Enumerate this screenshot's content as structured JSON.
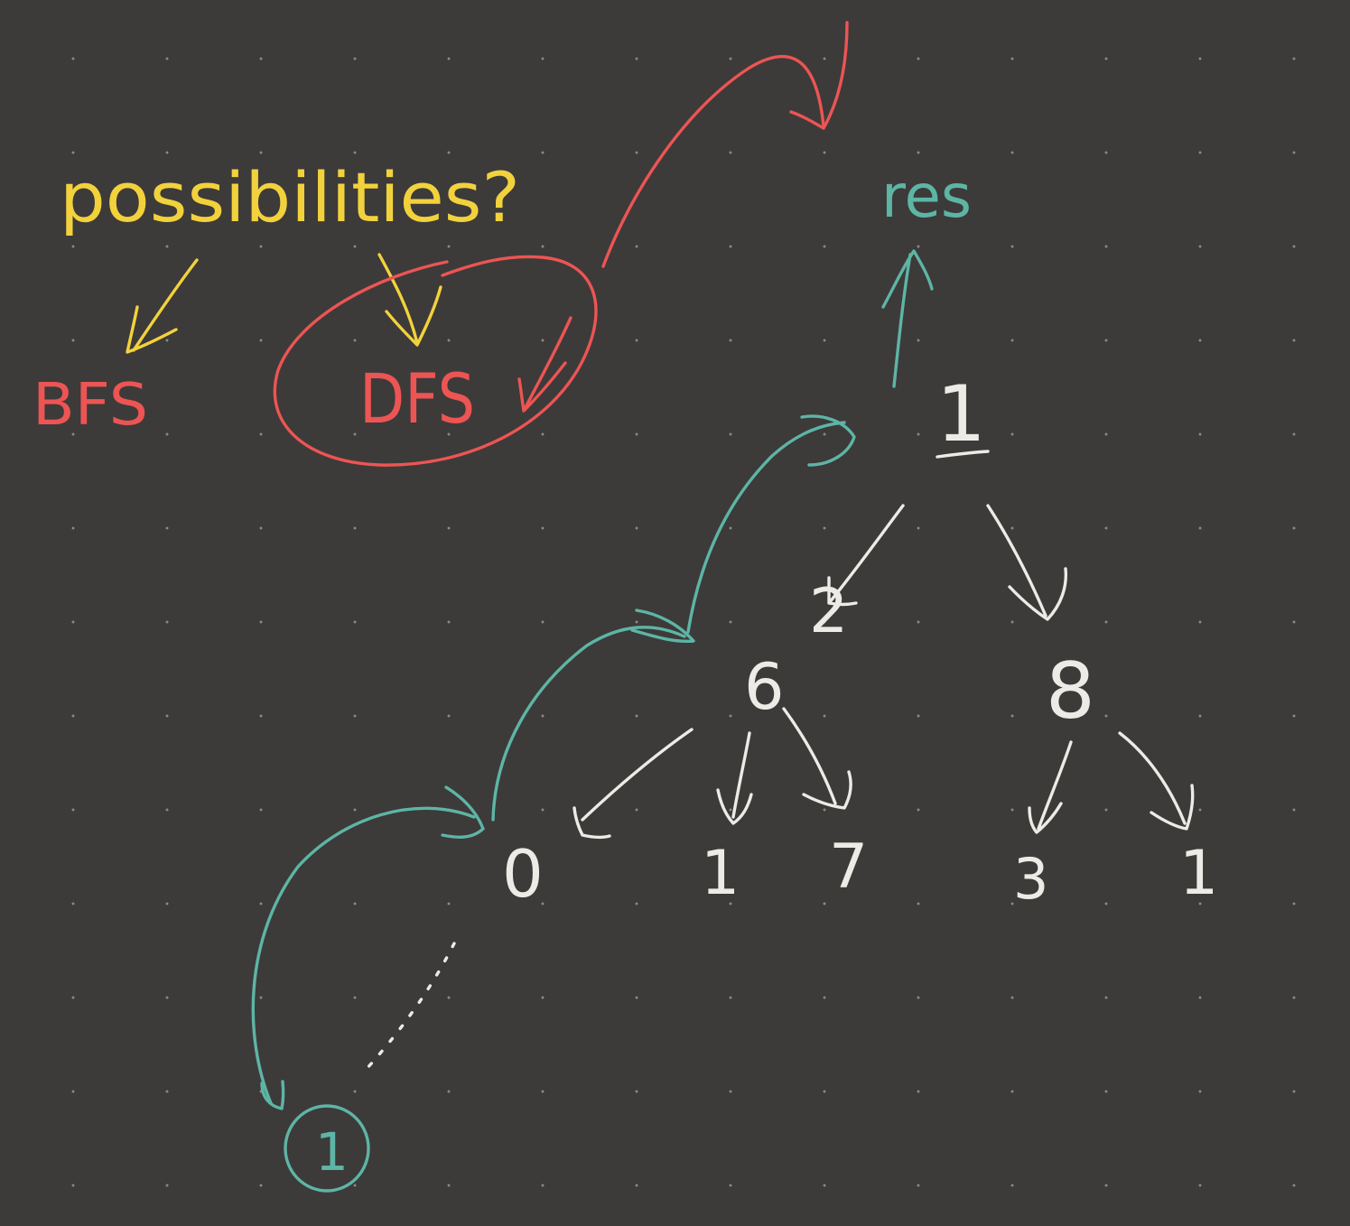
{
  "canvas": {
    "background_color": "#3d3a3a",
    "dot_color": "#8c8888"
  },
  "colors": {
    "yellow": "#f2d23c",
    "red": "#ec5553",
    "teal": "#5db5a5",
    "white": "#ecebe6"
  },
  "labels": {
    "question": "possibilities?",
    "bfs": "BFS",
    "dfs": "DFS",
    "result": "res",
    "leaf_circled": "1",
    "ellipsis": "......"
  },
  "tree": {
    "root": "1",
    "level1": [
      "2",
      "8"
    ],
    "level2": [
      "6"
    ],
    "level3": [
      "0",
      "1",
      "7",
      "3",
      "1"
    ]
  }
}
